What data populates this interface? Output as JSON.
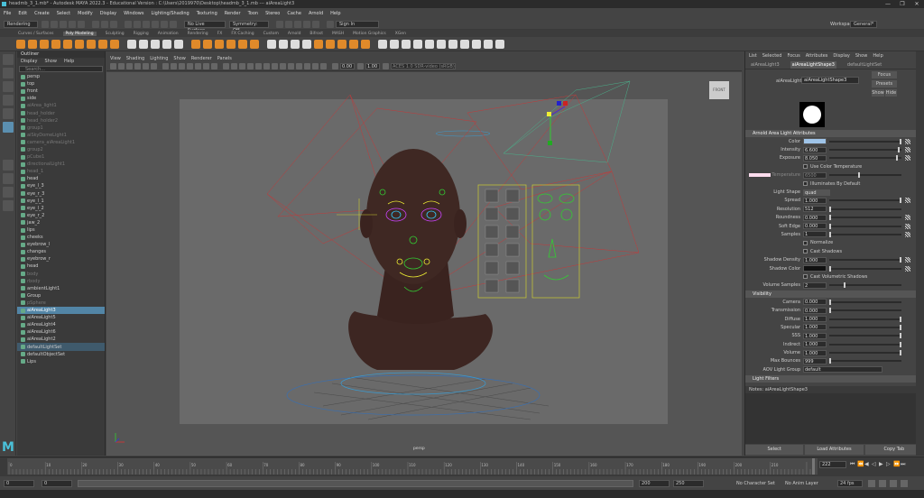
{
  "window": {
    "title": "headmb_3_1.mb* - Autodesk MAYA 2022.3 - Educational Version : C:\\Users\\2019970\\Desktop\\headmb_3_1.mb --- aiAreaLight3",
    "controls": [
      "—",
      "❐",
      "✕"
    ]
  },
  "menubar": [
    "File",
    "Edit",
    "Create",
    "Select",
    "Modify",
    "Display",
    "Windows",
    "Lighting/Shading",
    "Texturing",
    "Render",
    "Toon",
    "Stereo",
    "Cache",
    "Arnold",
    "Help"
  ],
  "statusline": {
    "mode": "Rendering",
    "no_live": "No Live Surface",
    "symmetry": "Symmetry: Off",
    "signin": "Sign In",
    "workspace_label": "Workspace:",
    "workspace_value": "General*"
  },
  "shelf_tabs": [
    "Curves / Surfaces",
    "Poly Modeling",
    "Sculpting",
    "Rigging",
    "Animation",
    "Rendering",
    "FX",
    "FX Caching",
    "Custom",
    "Arnold",
    "Bifrost",
    "MASH",
    "Motion Graphics",
    "XGen"
  ],
  "shelf_active": "Poly Modeling",
  "outliner": {
    "title": "Outliner",
    "menu": [
      "Display",
      "Show",
      "Help"
    ],
    "search_placeholder": "Search...",
    "items": [
      {
        "label": "persp",
        "state": "normal"
      },
      {
        "label": "top",
        "state": "normal"
      },
      {
        "label": "front",
        "state": "normal"
      },
      {
        "label": "side",
        "state": "normal"
      },
      {
        "label": "aiArea_light1",
        "state": "dim"
      },
      {
        "label": "head_holder",
        "state": "dim"
      },
      {
        "label": "head_holder2",
        "state": "dim"
      },
      {
        "label": "group1",
        "state": "dim"
      },
      {
        "label": "aiSkyDomeLight1",
        "state": "dim"
      },
      {
        "label": "camera_aiAreaLight1",
        "state": "dim"
      },
      {
        "label": "group2",
        "state": "dim"
      },
      {
        "label": "pCube1",
        "state": "dim"
      },
      {
        "label": "directionalLight1",
        "state": "dim"
      },
      {
        "label": "head_1",
        "state": "dim"
      },
      {
        "label": "head",
        "state": "normal"
      },
      {
        "label": "eye_l_3",
        "state": "normal"
      },
      {
        "label": "eye_r_3",
        "state": "normal"
      },
      {
        "label": "eye_l_1",
        "state": "normal"
      },
      {
        "label": "eye_l_2",
        "state": "normal"
      },
      {
        "label": "eye_r_2",
        "state": "normal"
      },
      {
        "label": "jaw_2",
        "state": "normal"
      },
      {
        "label": "lips",
        "state": "normal"
      },
      {
        "label": "cheeks",
        "state": "normal"
      },
      {
        "label": "eyebrow_l",
        "state": "normal"
      },
      {
        "label": "changes",
        "state": "normal"
      },
      {
        "label": "eyebrow_r",
        "state": "normal"
      },
      {
        "label": "head",
        "state": "normal"
      },
      {
        "label": "body",
        "state": "dim"
      },
      {
        "label": "rbody",
        "state": "dim"
      },
      {
        "label": "ambientLight1",
        "state": "normal"
      },
      {
        "label": "Group",
        "state": "normal"
      },
      {
        "label": "pSphere",
        "state": "dim"
      },
      {
        "label": "aiAreaLight3",
        "state": "sel"
      },
      {
        "label": "aiAreaLight5",
        "state": "normal"
      },
      {
        "label": "aiAreaLight4",
        "state": "normal"
      },
      {
        "label": "aiAreaLight6",
        "state": "normal"
      },
      {
        "label": "aiAreaLight2",
        "state": "normal"
      },
      {
        "label": "defaultLightSet",
        "state": "sel2"
      },
      {
        "label": "defaultObjectSet",
        "state": "normal"
      },
      {
        "label": "Lips",
        "state": "normal"
      }
    ]
  },
  "viewport": {
    "menu": [
      "View",
      "Shading",
      "Lighting",
      "Show",
      "Renderer",
      "Panels"
    ],
    "field1": "0.00",
    "field2": "1.00",
    "colorspace": "ACES 1.0 SDR-video (sRGB)",
    "camera_label": "persp",
    "cube_label": "FRONT"
  },
  "attribute_editor": {
    "menu": [
      "List",
      "Selected",
      "Focus",
      "Attributes",
      "Display",
      "Show",
      "Help"
    ],
    "tabs": [
      "aiAreaLight3",
      "aiAreaLightShape3",
      "defaultLightSet"
    ],
    "active_tab": "aiAreaLightShape3",
    "node_label": "aiAreaLight:",
    "node_value": "aiAreaLightShape3",
    "btn_focus": "Focus",
    "btn_presets": "Presets",
    "btn_show": "Show",
    "btn_hide": "Hide",
    "section_arnold": "Arnold Area Light Attributes",
    "rows": [
      {
        "label": "Color",
        "value": "",
        "knob": 0.98,
        "map": true,
        "color": "#9fc4e8"
      },
      {
        "label": "Intensity",
        "value": "6.600",
        "knob": 0.95,
        "map": true
      },
      {
        "label": "Exposure",
        "value": "8.050",
        "knob": 0.92,
        "map": true
      }
    ],
    "use_color_temp": "Use Color Temperature",
    "temperature_label": "Temperature",
    "temperature_value": "6500",
    "illuminates_default": "Illuminates By Default",
    "light_shape_label": "Light Shape",
    "light_shape_value": "quad",
    "rows2": [
      {
        "label": "Spread",
        "value": "1.000",
        "knob": 0.98,
        "map": true
      },
      {
        "label": "Resolution",
        "value": "512",
        "knob": 0.0,
        "map": false
      },
      {
        "label": "Roundness",
        "value": "0.000",
        "knob": 0.0,
        "map": true
      },
      {
        "label": "Soft Edge",
        "value": "0.000",
        "knob": 0.0,
        "map": true
      },
      {
        "label": "Samples",
        "value": "1",
        "knob": 0.0,
        "map": true
      }
    ],
    "normalize": "Normalize",
    "cast_shadows": "Cast Shadows",
    "rows3": [
      {
        "label": "Shadow Density",
        "value": "1.000",
        "knob": 0.98,
        "map": true
      },
      {
        "label": "Shadow Color",
        "value": "",
        "knob": 0.0,
        "map": true,
        "color": "#111111"
      }
    ],
    "cast_vol_shadows": "Cast Volumetric Shadows",
    "volume_samples_label": "Volume Samples",
    "volume_samples_value": "2",
    "section_visibility": "Visibility",
    "rows4": [
      {
        "label": "Camera",
        "value": "0.000",
        "knob": 0.0
      },
      {
        "label": "Transmission",
        "value": "0.000",
        "knob": 0.0
      },
      {
        "label": "Diffuse",
        "value": "1.000",
        "knob": 0.98
      },
      {
        "label": "Specular",
        "value": "1.000",
        "knob": 0.98
      },
      {
        "label": "SSS",
        "value": "1.000",
        "knob": 0.98
      },
      {
        "label": "Indirect",
        "value": "1.000",
        "knob": 0.98
      },
      {
        "label": "Volume",
        "value": "1.000",
        "knob": 0.98
      },
      {
        "label": "Max Bounces",
        "value": "999",
        "knob": 0.0
      }
    ],
    "aov_label": "AOV Light Group",
    "aov_value": "default",
    "section_filters": "Light Filters",
    "notes_label": "Notes: aiAreaLightShape3",
    "bottom_buttons": [
      "Select",
      "Load Attributes",
      "Copy Tab"
    ]
  },
  "timeline": {
    "ticks": [
      "0",
      "10",
      "20",
      "30",
      "40",
      "50",
      "60",
      "70",
      "80",
      "90",
      "100",
      "110",
      "120",
      "130",
      "140",
      "150",
      "160",
      "170",
      "180",
      "190",
      "200",
      "210"
    ],
    "current_frame": "222",
    "range_start": "0",
    "range_inner_start": "0",
    "range_inner_end": "200",
    "range_end": "250",
    "char_set": "No Character Set",
    "anim_layer": "No Anim Layer",
    "fps": "24 fps"
  }
}
